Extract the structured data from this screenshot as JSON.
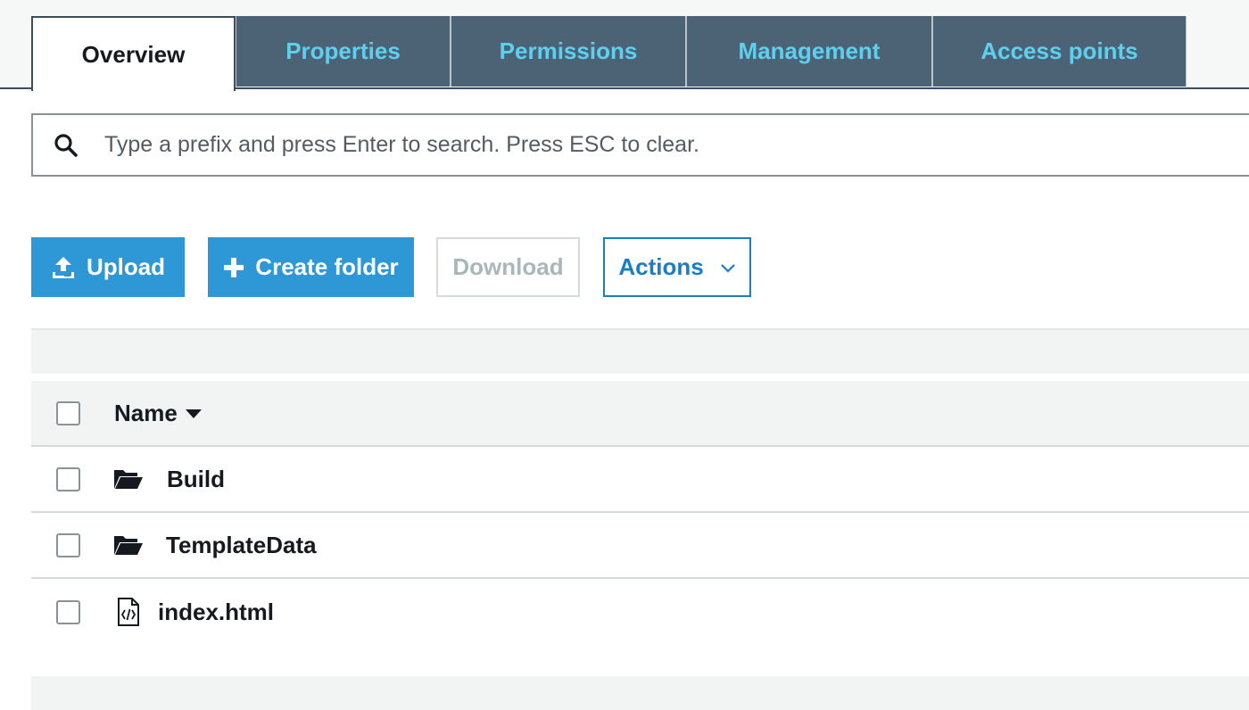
{
  "tabs": [
    {
      "label": "Overview",
      "active": true
    },
    {
      "label": "Properties",
      "active": false
    },
    {
      "label": "Permissions",
      "active": false
    },
    {
      "label": "Management",
      "active": false
    },
    {
      "label": "Access points",
      "active": false
    }
  ],
  "search": {
    "placeholder": "Type a prefix and press Enter to search. Press ESC to clear.",
    "icon": "search-icon"
  },
  "toolbar": {
    "upload_label": "Upload",
    "create_folder_label": "Create folder",
    "download_label": "Download",
    "actions_label": "Actions"
  },
  "table": {
    "column_name": "Name",
    "rows": [
      {
        "name": "Build",
        "type": "folder"
      },
      {
        "name": "TemplateData",
        "type": "folder"
      },
      {
        "name": "index.html",
        "type": "file"
      }
    ]
  },
  "colors": {
    "tab_bg": "#4c6275",
    "tab_text": "#5ed0ef",
    "primary_button": "#2e98d6",
    "outline_button": "#1b7dc4"
  }
}
